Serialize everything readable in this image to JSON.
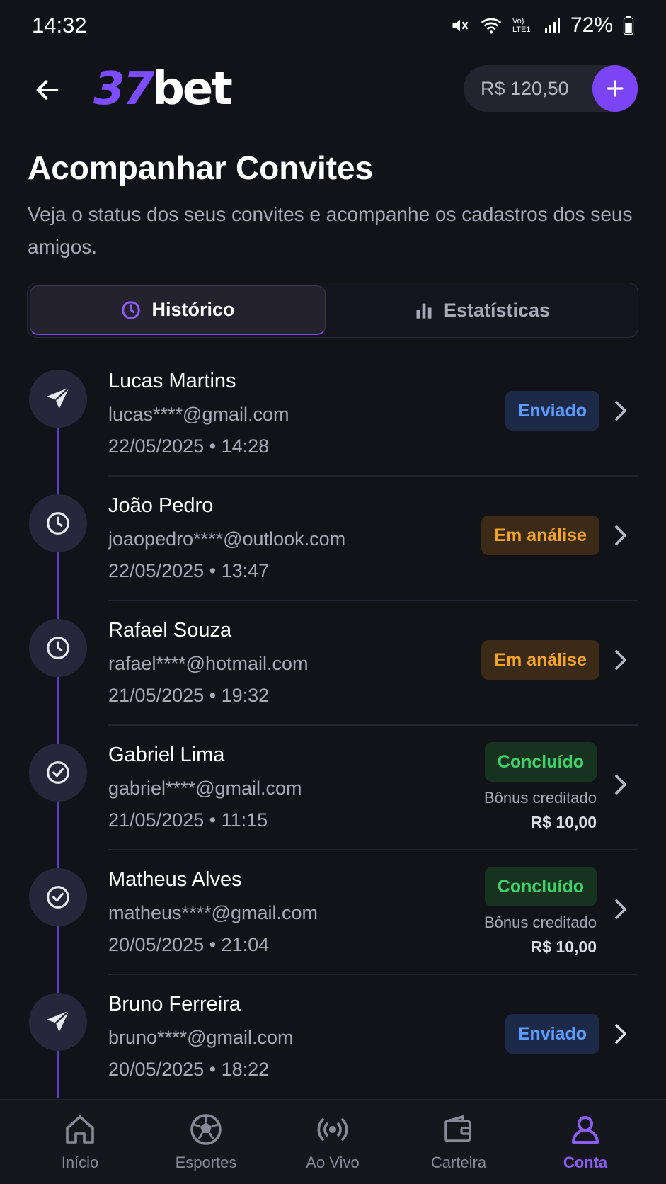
{
  "status_bar": {
    "time": "14:32",
    "battery": "72%",
    "network_label": "Vo) LTE1",
    "icons": [
      "mute-icon",
      "wifi-icon",
      "signal-icon",
      "battery-icon"
    ]
  },
  "header": {
    "logo_num": "37",
    "logo_word": "bet",
    "balance": "R$ 120,50"
  },
  "page": {
    "title": "Acompanhar Convites",
    "subtitle": "Veja o status dos seus convites e acompanhe os cadastros dos seus amigos."
  },
  "tabs": [
    {
      "label": "Histórico",
      "icon": "clock-icon",
      "active": true
    },
    {
      "label": "Estatísticas",
      "icon": "bar-chart-icon",
      "active": false
    }
  ],
  "invites": [
    {
      "name": "Lucas Martins",
      "email": "lucas****@gmail.com",
      "date": "22/05/2025 • 14:28",
      "status": "Enviado",
      "status_type": "sent",
      "icon": "send-icon"
    },
    {
      "name": "João Pedro",
      "email": "joaopedro****@outlook.com",
      "date": "22/05/2025 • 13:47",
      "status": "Em análise",
      "status_type": "review",
      "icon": "clock-icon"
    },
    {
      "name": "Rafael Souza",
      "email": "rafael****@hotmail.com",
      "date": "21/05/2025 • 19:32",
      "status": "Em análise",
      "status_type": "review",
      "icon": "clock-icon"
    },
    {
      "name": "Gabriel Lima",
      "email": "gabriel****@gmail.com",
      "date": "21/05/2025 • 11:15",
      "status": "Concluído",
      "status_type": "done",
      "icon": "check-circle-icon",
      "bonus_label": "Bônus creditado",
      "bonus_amount": "R$ 10,00"
    },
    {
      "name": "Matheus Alves",
      "email": "matheus****@gmail.com",
      "date": "20/05/2025 • 21:04",
      "status": "Concluído",
      "status_type": "done",
      "icon": "check-circle-icon",
      "bonus_label": "Bônus creditado",
      "bonus_amount": "R$ 10,00"
    },
    {
      "name": "Bruno Ferreira",
      "email": "bruno****@gmail.com",
      "date": "20/05/2025 • 18:22",
      "status": "Enviado",
      "status_type": "sent",
      "icon": "send-icon"
    }
  ],
  "nav": [
    {
      "label": "Início",
      "icon": "home-icon"
    },
    {
      "label": "Esportes",
      "icon": "soccer-ball-icon"
    },
    {
      "label": "Ao Vivo",
      "icon": "live-broadcast-icon"
    },
    {
      "label": "Carteira",
      "icon": "wallet-icon"
    },
    {
      "label": "Conta",
      "icon": "user-icon",
      "active": true
    }
  ],
  "colors": {
    "accent": "#7b45f5",
    "background": "#121219",
    "sent": "#5d9bff",
    "review": "#f5a425",
    "done": "#3fd16b"
  }
}
